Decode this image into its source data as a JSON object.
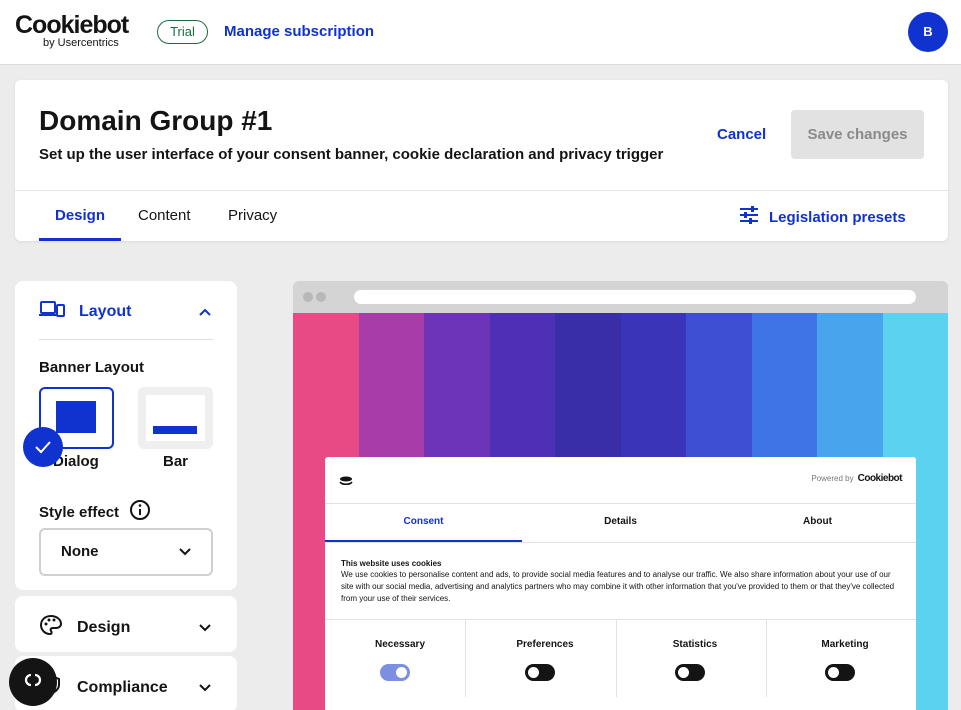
{
  "topbar": {
    "logo_main": "Cookiebot",
    "logo_sub": "by Usercentrics",
    "trial_badge": "Trial",
    "manage_link": "Manage subscription",
    "avatar_initial": "B"
  },
  "header": {
    "title": "Domain Group #1",
    "subtitle": "Set up the user interface of your consent banner, cookie declaration and privacy trigger",
    "cancel_label": "Cancel",
    "save_label": "Save changes",
    "tabs": [
      "Design",
      "Content",
      "Privacy"
    ],
    "active_tab": "Design",
    "legislation_label": "Legislation presets"
  },
  "sidebar": {
    "layout": {
      "title": "Layout",
      "banner_layout_label": "Banner Layout",
      "options": [
        "Dialog",
        "Bar"
      ],
      "selected": "Dialog",
      "style_effect_label": "Style effect",
      "style_effect_value": "None"
    },
    "design_title": "Design",
    "compliance_title": "Compliance"
  },
  "preview": {
    "powered_by": "Powered by",
    "powered_brand": "Cookiebot",
    "tabs": [
      "Consent",
      "Details",
      "About"
    ],
    "active_tab": "Consent",
    "heading": "This website uses cookies",
    "body": "We use cookies to personalise content and ads, to provide social media features and to analyse our traffic. We also share information about your use of our site with our social media, advertising and analytics partners who may combine it with other information that you've provided to them or that they've collected from your use of their services.",
    "categories": [
      {
        "name": "Necessary",
        "on": true
      },
      {
        "name": "Preferences",
        "on": false
      },
      {
        "name": "Statistics",
        "on": false
      },
      {
        "name": "Marketing",
        "on": false
      }
    ]
  },
  "colors": {
    "accent": "#1032cf",
    "trial_green": "#1e6b45"
  }
}
